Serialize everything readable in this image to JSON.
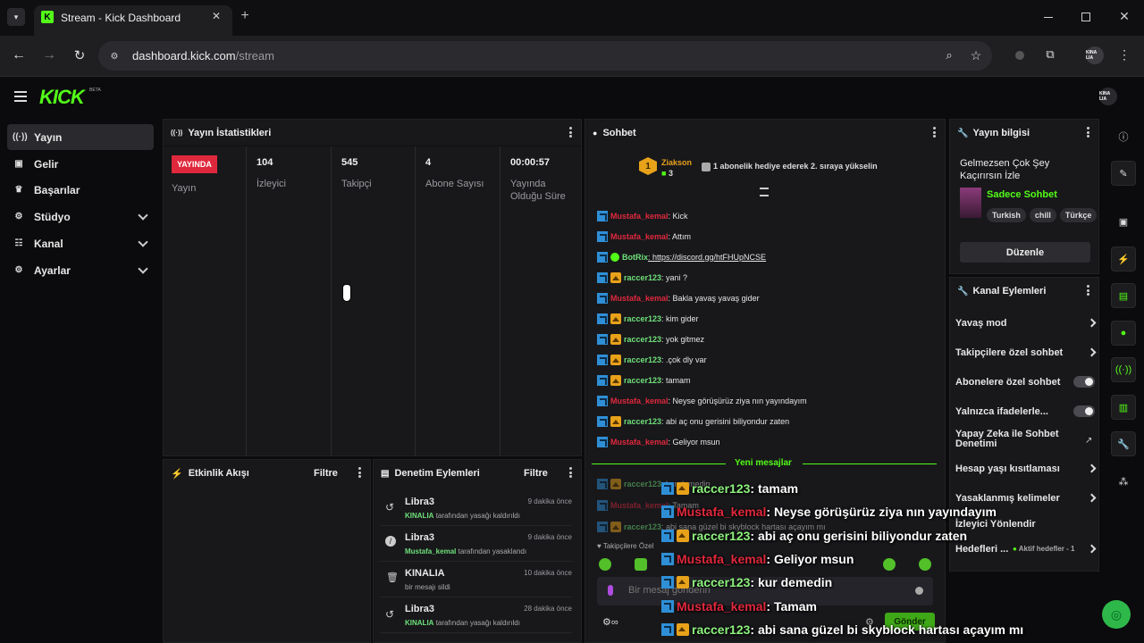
{
  "browser": {
    "tab_title": "Stream - Kick Dashboard",
    "url_host": "dashboard.kick.com",
    "url_path": "/stream",
    "profile_label": "KINA LIA"
  },
  "app": {
    "logo": "KICK",
    "logo_tag": "BETA",
    "avatar_label": "KINA LIA"
  },
  "sidebar": {
    "items": [
      {
        "label": "Yayın",
        "icon": "broadcast-icon"
      },
      {
        "label": "Gelir",
        "icon": "wallet-icon"
      },
      {
        "label": "Başarılar",
        "icon": "trophy-icon"
      },
      {
        "label": "Stüdyo",
        "icon": "studio-icon"
      },
      {
        "label": "Kanal",
        "icon": "channel-icon"
      },
      {
        "label": "Ayarlar",
        "icon": "gear-icon"
      }
    ]
  },
  "stats": {
    "title": "Yayın İstatistikleri",
    "live_badge": "YAYINDA",
    "live_label": "Yayın",
    "cols": [
      {
        "value": "104",
        "label": "İzleyici"
      },
      {
        "value": "545",
        "label": "Takipçi"
      },
      {
        "value": "4",
        "label": "Abone Sayısı"
      },
      {
        "value": "00:00:57",
        "label": "Yayında Olduğu Süre"
      }
    ]
  },
  "activity": {
    "title": "Etkinlik Akışı",
    "filter": "Filtre"
  },
  "moderation": {
    "title": "Denetim Eylemleri",
    "filter": "Filtre",
    "rows": [
      {
        "user": "Libra3",
        "time": "9 dakika önce",
        "actor": "KINALIA",
        "action": "tarafından yasağı kaldırıldı"
      },
      {
        "user": "Libra3",
        "time": "9 dakika önce",
        "actor": "Mustafa_kemal",
        "action": "tarafından yasaklandı"
      },
      {
        "user": "KINALIA",
        "time": "10 dakika önce",
        "actor": "",
        "action": "bir mesajı sildi"
      },
      {
        "user": "Libra3",
        "time": "28 dakika önce",
        "actor": "KINALIA",
        "action": "tarafından yasağı kaldırıldı"
      }
    ]
  },
  "chat": {
    "title": "Sohbet",
    "top_gifter": "Ziakson",
    "gifter_count": "3",
    "gifter_rank": "1",
    "gift_prompt": "1 abonelik hediye ederek 2. sıraya yükselin",
    "messages": [
      {
        "user": "Mustafa_kemal",
        "color": "red",
        "text": ": Kick",
        "crown": false
      },
      {
        "user": "Mustafa_kemal",
        "color": "red",
        "text": ": Attım",
        "crown": false
      },
      {
        "user": "BotRix",
        "color": "green",
        "text": ": https://discord.gg/htFHUpNCSE",
        "crown": false,
        "bot": true
      },
      {
        "user": "raccer123",
        "color": "green",
        "text": ": yani ?",
        "crown": true
      },
      {
        "user": "Mustafa_kemal",
        "color": "red",
        "text": ": Bakla yavaş yavaş gider",
        "crown": false
      },
      {
        "user": "raccer123",
        "color": "green",
        "text": ": kim gider",
        "crown": true
      },
      {
        "user": "raccer123",
        "color": "green",
        "text": ": yok gitmez",
        "crown": true
      },
      {
        "user": "raccer123",
        "color": "green",
        "text": ": .çok dly var",
        "crown": true
      },
      {
        "user": "raccer123",
        "color": "green",
        "text": ": tamam",
        "crown": true
      },
      {
        "user": "Mustafa_kemal",
        "color": "red",
        "text": ": Neyse görüşürüz ziya nın yayındayım",
        "crown": false
      },
      {
        "user": "raccer123",
        "color": "green",
        "text": ": abi aç onu gerisini biliyondur zaten",
        "crown": true
      },
      {
        "user": "Mustafa_kemal",
        "color": "red",
        "text": ": Geliyor msun",
        "crown": false
      }
    ],
    "new_messages": "Yeni mesajlar",
    "after": [
      {
        "user": "raccer123",
        "text": ": kur demedin"
      },
      {
        "user": "Mustafa_kemal",
        "text": ": Tamam"
      },
      {
        "user": "raccer123",
        "text": ": abi sana güzel bi skyblock hartası açayım mı"
      }
    ],
    "followers_only": "Takipçilere Özel",
    "input_placeholder": "Bir mesaj gönderin",
    "send": "Gönder"
  },
  "overlay": [
    {
      "user": "raccer123",
      "color": "green",
      "text": ": tamam",
      "crown": true
    },
    {
      "user": "Mustafa_kemal",
      "color": "red",
      "text": ": Neyse görüşürüz ziya nın yayındayım",
      "crown": false
    },
    {
      "user": "raccer123",
      "color": "green",
      "text": ": abi aç onu gerisini biliyondur zaten",
      "crown": true
    },
    {
      "user": "Mustafa_kemal",
      "color": "red",
      "text": ": Geliyor msun",
      "crown": false
    },
    {
      "user": "raccer123",
      "color": "green",
      "text": ": kur demedin",
      "crown": true
    },
    {
      "user": "Mustafa_kemal",
      "color": "red",
      "text": ": Tamam",
      "crown": false
    },
    {
      "user": "raccer123",
      "color": "green",
      "text": ": abi sana güzel bi skyblock hartası açayım mı",
      "crown": true
    }
  ],
  "stream_info": {
    "title": "Yayın bilgisi",
    "stream_title_line1": "Gelmezsen Çok Şey",
    "stream_title_line2": "Kaçırırsın İzle",
    "category": "Sadece Sohbet",
    "tags": [
      "Turkish",
      "chill",
      "Türkçe"
    ],
    "edit": "Düzenle"
  },
  "channel_actions": {
    "title": "Kanal Eylemleri",
    "items": [
      {
        "label": "Yavaş mod",
        "control": "arrow"
      },
      {
        "label": "Takipçilere özel sohbet",
        "control": "arrow"
      },
      {
        "label": "Abonelere özel sohbet",
        "control": "toggle"
      },
      {
        "label": "Yalnızca ifadelerle...",
        "control": "toggle"
      },
      {
        "label": "Yapay Zeka ile Sohbet Denetimi",
        "control": "external"
      },
      {
        "label": "Hesap yaşı kısıtlaması",
        "control": "arrow"
      },
      {
        "label": "Yasaklanmış kelimeler",
        "control": "arrow"
      },
      {
        "label": "İzleyici Yönlendir",
        "control": "none"
      },
      {
        "label": "Hedefleri ...",
        "control": "arrow"
      }
    ],
    "goal_badge": "Aktif hedefler - 1"
  },
  "colors": {
    "brand": "#53fc18",
    "live": "#e0283c",
    "panel": "#18181b"
  }
}
